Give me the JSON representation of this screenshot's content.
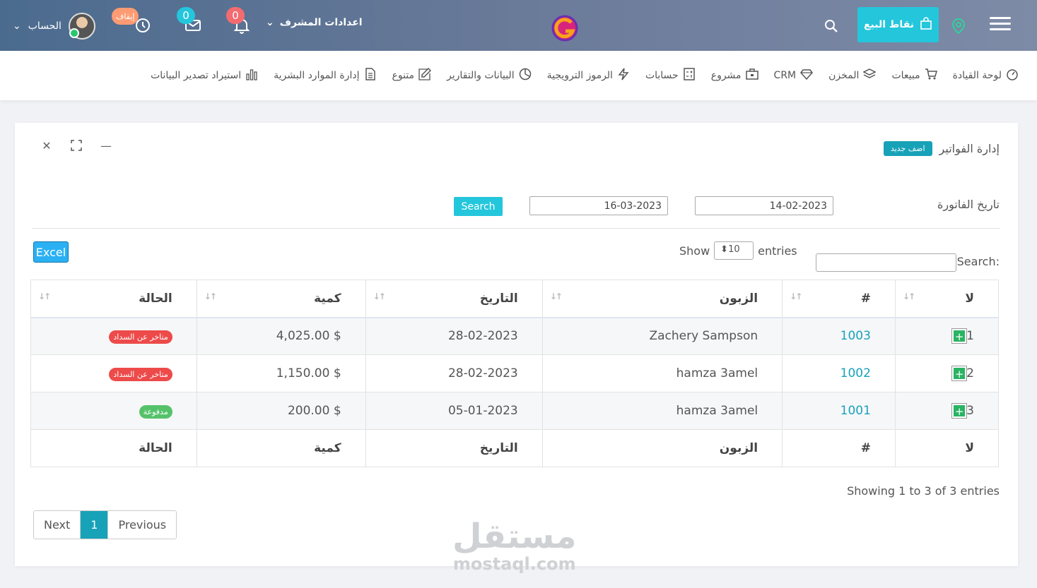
{
  "topbar": {
    "pos_label": "نقاط البيع",
    "admin_settings": "اعدادات المشرف",
    "notif_count": "0",
    "mail_count": "0",
    "stop_label": "إيقاف",
    "account_label": "الحساب"
  },
  "nav": [
    {
      "label": "لوحة القيادة",
      "icon": "dashboard-icon"
    },
    {
      "label": "مبيعات",
      "icon": "cart-icon"
    },
    {
      "label": "المخزن",
      "icon": "layers-icon"
    },
    {
      "label": "CRM",
      "icon": "diamond-icon"
    },
    {
      "label": "مشروع",
      "icon": "briefcase-icon"
    },
    {
      "label": "حسابات",
      "icon": "calculator-icon"
    },
    {
      "label": "الرموز الترويجية",
      "icon": "bolt-icon"
    },
    {
      "label": "البيانات والتقارير",
      "icon": "pie-icon"
    },
    {
      "label": "متنوع",
      "icon": "edit-icon"
    },
    {
      "label": "إدارة الموارد البشرية",
      "icon": "file-icon"
    },
    {
      "label": "استيراد تصدير البيانات",
      "icon": "bar-chart-icon"
    }
  ],
  "card": {
    "title": "إدارة الفواتير",
    "add_new": "اضف جديد"
  },
  "filter": {
    "label": "تاريخ الفاتورة",
    "date_from": "14-02-2023",
    "date_to": "16-03-2023",
    "search_btn": "Search"
  },
  "table_controls": {
    "excel": "Excel",
    "show": "Show",
    "entries": "entries",
    "page_size": "10",
    "search_label": "Search:"
  },
  "table": {
    "headers": [
      "لا",
      "#",
      "الزبون",
      "التاريخ",
      "كمية",
      "الحالة"
    ],
    "rows": [
      {
        "no": "1",
        "id": "1003",
        "customer": "Zachery Sampson",
        "date": "28-02-2023",
        "amount": "4,025.00 $",
        "status": "متاخر عن السداد",
        "status_color": "#ed4a4a"
      },
      {
        "no": "2",
        "id": "1002",
        "customer": "hamza 3amel",
        "date": "28-02-2023",
        "amount": "1,150.00 $",
        "status": "متاخر عن السداد",
        "status_color": "#ed4a4a"
      },
      {
        "no": "3",
        "id": "1001",
        "customer": "hamza 3amel",
        "date": "05-01-2023",
        "amount": "200.00 $",
        "status": "مدفوعة",
        "status_color": "#55c26b"
      }
    ]
  },
  "footer": {
    "showing": "Showing 1 to 3 of 3 entries",
    "next": "Next",
    "page": "1",
    "previous": "Previous"
  },
  "watermark": {
    "arabic": "مستقل",
    "latin": "mostaql.com"
  }
}
